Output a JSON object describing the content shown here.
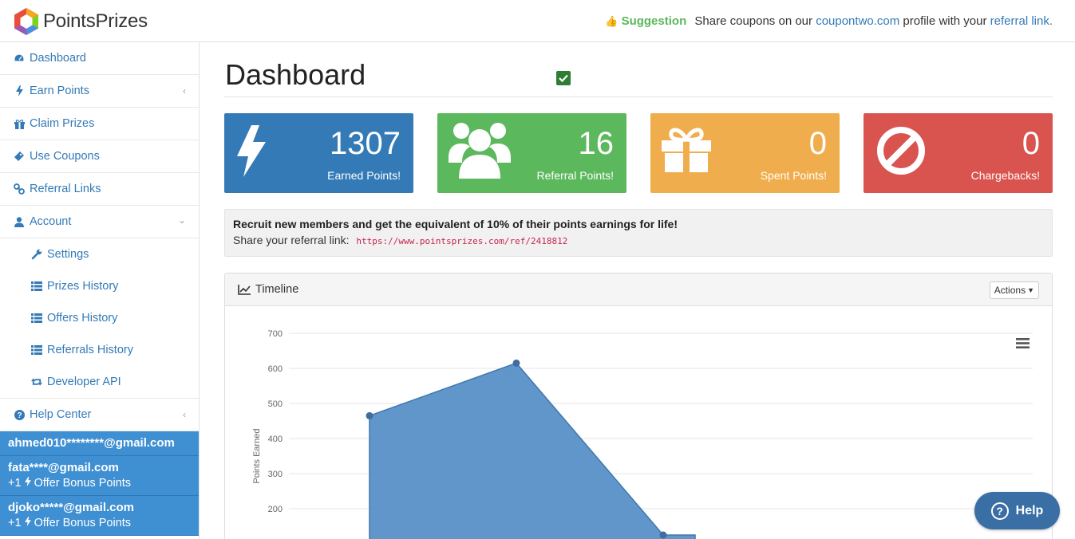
{
  "brand": {
    "name": "PointsPrizes"
  },
  "suggestion": {
    "label": "Suggestion",
    "text_before": "Share coupons on our",
    "site_link": "coupontwo.com",
    "text_middle": "profile with your",
    "ref_link": "referral link."
  },
  "sidebar": {
    "items": [
      {
        "label": "Dashboard",
        "icon": "dashboard-icon"
      },
      {
        "label": "Earn Points",
        "icon": "bolt-icon"
      },
      {
        "label": "Claim Prizes",
        "icon": "gift-icon"
      },
      {
        "label": "Use Coupons",
        "icon": "ticket-icon"
      },
      {
        "label": "Referral Links",
        "icon": "link-icon"
      },
      {
        "label": "Account",
        "icon": "user-icon"
      }
    ],
    "account_sub": [
      {
        "label": "Settings",
        "icon": "wrench-icon"
      },
      {
        "label": "Prizes History",
        "icon": "list-icon"
      },
      {
        "label": "Offers History",
        "icon": "list-icon"
      },
      {
        "label": "Referrals History",
        "icon": "list-icon"
      },
      {
        "label": "Developer API",
        "icon": "retweet-icon"
      }
    ],
    "help": {
      "label": "Help Center",
      "icon": "question-circle-icon"
    }
  },
  "activity": [
    {
      "email": "ahmed010********@gmail.com",
      "sub": ""
    },
    {
      "email": "fata****@gmail.com",
      "sub_prefix": "+1",
      "sub_text": "Offer Bonus Points"
    },
    {
      "email": "djoko*****@gmail.com",
      "sub_prefix": "+1",
      "sub_text": "Offer Bonus Points"
    }
  ],
  "page": {
    "title": "Dashboard"
  },
  "stats": [
    {
      "value": "1307",
      "label": "Earned Points!",
      "color": "#337ab7",
      "icon": "bolt-icon"
    },
    {
      "value": "16",
      "label": "Referral Points!",
      "color": "#5cb85c",
      "icon": "users-icon"
    },
    {
      "value": "0",
      "label": "Spent Points!",
      "color": "#f0ad4e",
      "icon": "gift-icon"
    },
    {
      "value": "0",
      "label": "Chargebacks!",
      "color": "#d9534f",
      "icon": "ban-icon"
    }
  ],
  "referral": {
    "headline": "Recruit new members and get the equivalent of 10% of their points earnings for life!",
    "prompt": "Share your referral link:",
    "link": "https://www.pointsprizes.com/ref/2418812"
  },
  "timeline": {
    "title": "Timeline",
    "actions_label": "Actions"
  },
  "chart_data": {
    "type": "area",
    "ylabel": "Points Earned",
    "yticks": [
      200,
      300,
      400,
      500,
      600,
      700
    ],
    "ylim": [
      100,
      700
    ],
    "points": [
      465,
      615,
      125
    ],
    "color": "#4f8bc4"
  },
  "help_button": {
    "label": "Help"
  }
}
